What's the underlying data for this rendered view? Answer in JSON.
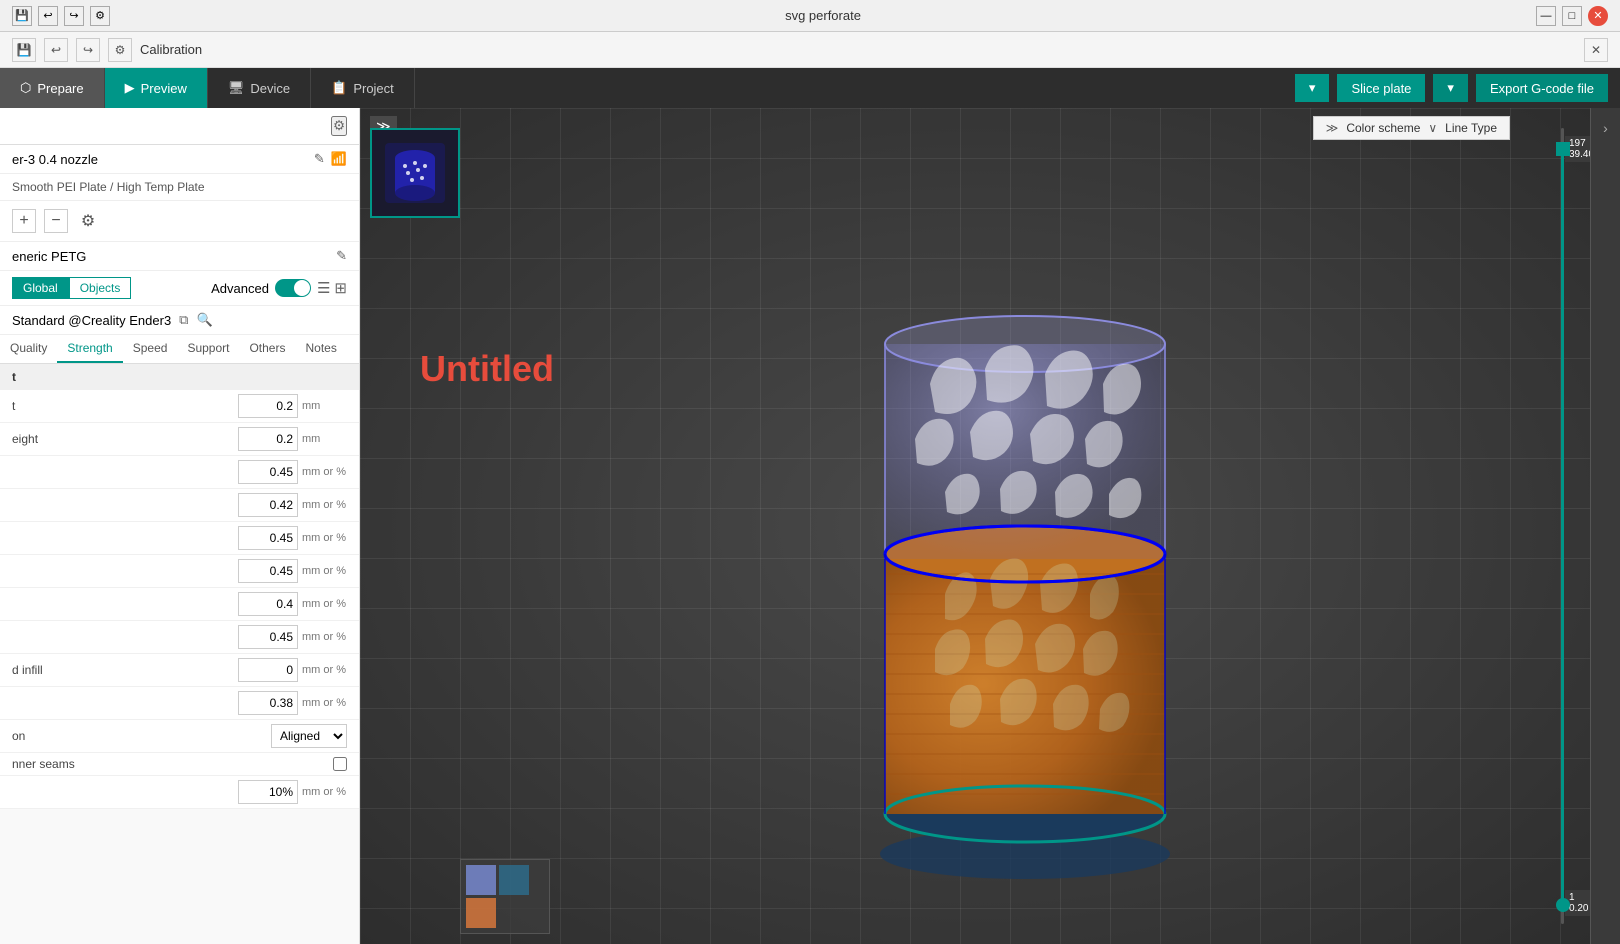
{
  "window": {
    "title": "svg perforate",
    "title_bar_controls": [
      "minimize",
      "maximize",
      "close"
    ]
  },
  "second_bar": {
    "save_icon": "💾",
    "undo_icon": "↩",
    "redo_icon": "↪",
    "settings_icon": "⚙",
    "calibration_label": "Calibration"
  },
  "tabs": [
    {
      "id": "prepare",
      "label": "Prepare"
    },
    {
      "id": "preview",
      "label": "Preview",
      "active": true
    },
    {
      "id": "device",
      "label": "Device"
    },
    {
      "id": "project",
      "label": "Project"
    }
  ],
  "toolbar": {
    "slice_label": "Slice plate",
    "export_label": "Export G-code file",
    "slice_dropdown": "▾",
    "export_dropdown": "▾"
  },
  "left_panel": {
    "gear_icon": "⚙",
    "nozzle_label": "er-3 0.4 nozzle",
    "nozzle_edit_icon": "✎",
    "nozzle_wifi_icon": "📶",
    "plate_label": "Smooth PEI Plate / High Temp Plate",
    "add_icon": "+",
    "remove_icon": "−",
    "settings_icon": "⚙",
    "material_label": "eneric PETG",
    "material_edit_icon": "✎",
    "global_label": "Global",
    "objects_label": "Objects",
    "advanced_label": "Advanced",
    "profile_label": "Standard @Creality Ender3",
    "profile_copy_icon": "⧉",
    "profile_search_icon": "🔍",
    "params_tabs": [
      "Quality",
      "Strength",
      "Speed",
      "Support",
      "Others",
      "Notes"
    ],
    "active_params_tab": "Quality",
    "section_title": "t",
    "params": [
      {
        "label": "t",
        "value": "0.2",
        "unit": "mm"
      },
      {
        "label": "eight",
        "value": "0.2",
        "unit": "mm"
      },
      {
        "label": "",
        "value": "0.45",
        "unit": "mm or %"
      },
      {
        "label": "",
        "value": "0.42",
        "unit": "mm or %"
      },
      {
        "label": "",
        "value": "0.45",
        "unit": "mm or %"
      },
      {
        "label": "",
        "value": "0.45",
        "unit": "mm or %"
      },
      {
        "label": "",
        "value": "0.4",
        "unit": "mm or %"
      },
      {
        "label": "",
        "value": "0.45",
        "unit": "mm or %"
      },
      {
        "label": "d infill",
        "value": "0",
        "unit": "mm or %"
      },
      {
        "label": "",
        "value": "0.38",
        "unit": "mm or %"
      }
    ],
    "seam_label": "on",
    "seam_value": "Aligned",
    "seam_checkbox_label": "nner seams",
    "seam_checkbox_checked": false,
    "percent_label": "10%",
    "percent_unit": "mm or %"
  },
  "viewport": {
    "title": "Untitled",
    "collapse_icon": "≫",
    "color_scheme_label": "Color scheme",
    "color_scheme_arrow": "≫",
    "line_type_arrow": "∨",
    "line_type_label": "Line Type",
    "slider_top": "197",
    "slider_top_sub": "39.40",
    "slider_bottom": "1",
    "slider_bottom_sub": "0.20"
  },
  "thumbnail": {
    "border_color": "#009688"
  },
  "mini_map": {
    "colors": [
      "#7b8dd8",
      "#e07b3c",
      "#2d6e8e"
    ]
  }
}
